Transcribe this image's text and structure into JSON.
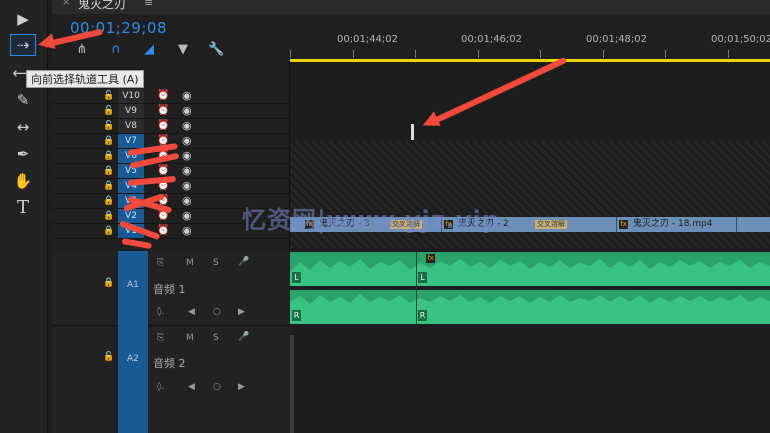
{
  "sequence": {
    "tab_title": "鬼灭之刃",
    "close_glyph": "×",
    "menu_glyph": "≡",
    "timecode": "00;01;29;08"
  },
  "ruler": {
    "labels": [
      "00;01;44;02",
      "00;01;46;02",
      "00;01;48;02",
      "00;01;50;02"
    ]
  },
  "tooltip": {
    "text": "向前选择轨道工具 (A)"
  },
  "video_tracks": [
    {
      "label": "V10",
      "locked": false
    },
    {
      "label": "V9",
      "locked": false
    },
    {
      "label": "V8",
      "locked": false
    },
    {
      "label": "V7",
      "locked": true
    },
    {
      "label": "V6",
      "locked": true
    },
    {
      "label": "V5",
      "locked": true
    },
    {
      "label": "V4",
      "locked": true
    },
    {
      "label": "V3",
      "locked": true
    },
    {
      "label": "V2",
      "locked": true
    },
    {
      "label": "V1",
      "locked": true
    }
  ],
  "clips": [
    {
      "name": "鬼灭之刃 - 3",
      "tag": "交叉溶解"
    },
    {
      "name": "鬼灭之刃 - 2",
      "tag": "交叉溶解"
    },
    {
      "name": "鬼灭之刃 - 18.mp4",
      "tag": ""
    }
  ],
  "audio_tracks": [
    {
      "label": "A1",
      "name": "音频 1",
      "m": "M",
      "s": "S"
    },
    {
      "label": "A2",
      "name": "音频 2",
      "m": "M",
      "s": "S"
    }
  ],
  "wave_labels": {
    "left": "L",
    "right": "R"
  },
  "watermark": "忆资网|www.yjz.vip",
  "icons": {
    "select": "selection-tool-icon",
    "track_select": "track-select-forward-tool-icon",
    "ripple": "ripple-edit-tool-icon",
    "razor": "razor-tool-icon",
    "slip": "slip-tool-icon",
    "pen": "pen-tool-icon",
    "hand": "hand-tool-icon",
    "type": "type-tool-icon",
    "snap": "snap-icon",
    "linked": "linked-selection-icon",
    "marker": "add-marker-icon",
    "settings": "wrench-icon"
  },
  "colors": {
    "accent_blue": "#2d8ceb",
    "audio_green": "#2aa36a",
    "clip_blue": "#6c8fb8",
    "annotation_red": "#f04a3c",
    "workarea_yellow": "#e8d500"
  }
}
